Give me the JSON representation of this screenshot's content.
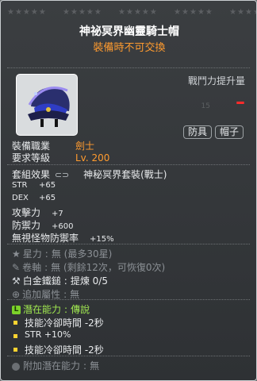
{
  "stars_row": [
    "★★★★★",
    "★★★★★",
    "★★★★★",
    "★★★★★",
    "★★★★★"
  ],
  "item": {
    "name": "神祕冥界幽靈騎士帽",
    "trade_note": "裝備時不可交換",
    "combat_power_label": "戰鬥力提升量",
    "combat_power_value": "15",
    "tags": [
      "防具",
      "帽子"
    ],
    "job_label": "裝備職業",
    "job_value": "劍士",
    "level_label": "要求等級",
    "level_value": "Lv. 200",
    "set_label": "套組效果",
    "set_value": "神秘冥界套裝(戰士)",
    "stats": [
      {
        "name": "STR",
        "value": "+65"
      },
      {
        "name": "DEX",
        "value": "+65"
      },
      {
        "name": "攻擊力",
        "value": "+7"
      },
      {
        "name": "防禦力",
        "value": "+600"
      },
      {
        "name": "無視怪物防禦率",
        "value": "+15%"
      }
    ],
    "enhance": [
      {
        "label": "星力",
        "value": "無 (最多30星)"
      },
      {
        "label": "卷軸",
        "value": "無 (剩餘12次，可恢復0次)"
      },
      {
        "label": "白金鐵鎚",
        "value": "提煉 0/5"
      },
      {
        "label": "追加屬性",
        "value": "無"
      }
    ],
    "potential_label": "潛在能力",
    "potential_grade": "傳說",
    "potentials": [
      "技能冷卻時間 -2秒",
      "STR +10%",
      "技能冷卻時間 -2秒"
    ],
    "bonus_potential_label": "附加潛在能力",
    "bonus_potential_value": "無"
  },
  "colors": {
    "accent": "#ff9b2f",
    "potential": "#a0e850",
    "bullet": "#ffd330"
  }
}
